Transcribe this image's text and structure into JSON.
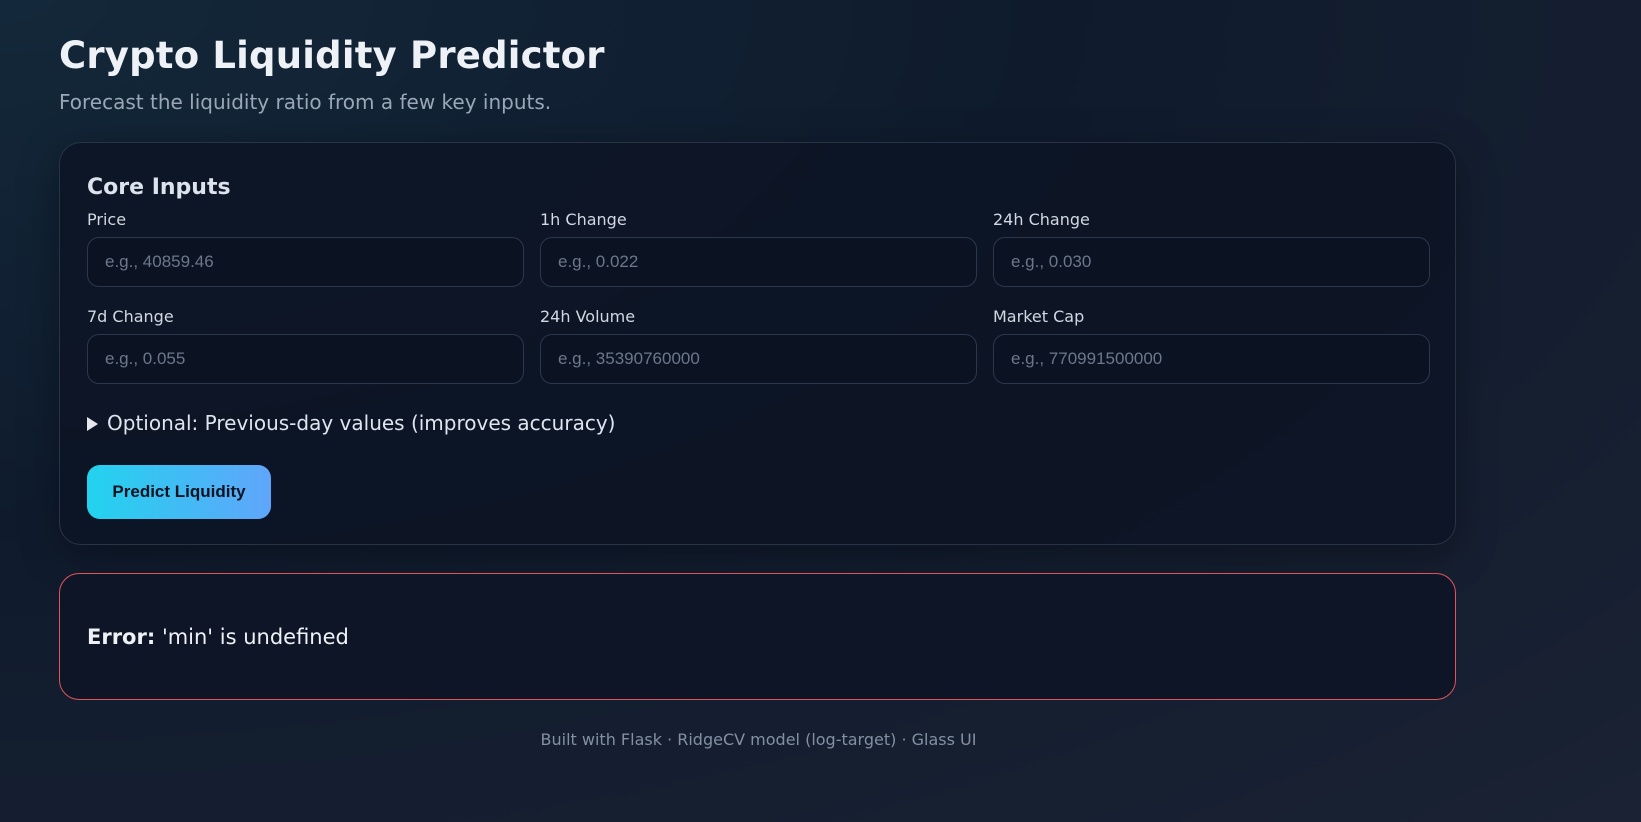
{
  "header": {
    "title": "Crypto Liquidity Predictor",
    "subtitle": "Forecast the liquidity ratio from a few key inputs."
  },
  "form": {
    "section_title": "Core Inputs",
    "fields": [
      {
        "label": "Price",
        "placeholder": "e.g., 40859.46",
        "value": ""
      },
      {
        "label": "1h Change",
        "placeholder": "e.g., 0.022",
        "value": ""
      },
      {
        "label": "24h Change",
        "placeholder": "e.g., 0.030",
        "value": ""
      },
      {
        "label": "7d Change",
        "placeholder": "e.g., 0.055",
        "value": ""
      },
      {
        "label": "24h Volume",
        "placeholder": "e.g., 35390760000",
        "value": ""
      },
      {
        "label": "Market Cap",
        "placeholder": "e.g., 770991500000",
        "value": ""
      }
    ],
    "optional_toggle": "Optional: Previous-day values (improves accuracy)",
    "submit_label": "Predict Liquidity"
  },
  "error": {
    "prefix": "Error:",
    "message": "'min' is undefined"
  },
  "footer": {
    "text": "Built with Flask · RidgeCV model (log-target) · Glass UI"
  },
  "colors": {
    "accent_start": "#22d3ee",
    "accent_end": "#60a5fa",
    "error_border": "#e2545a"
  }
}
